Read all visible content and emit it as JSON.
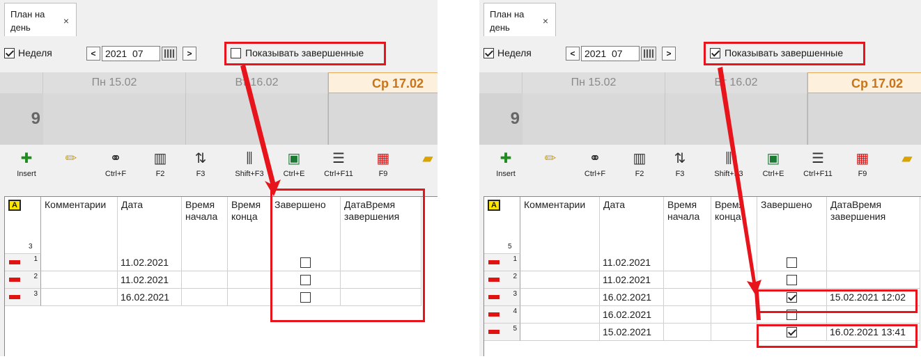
{
  "left": {
    "tab_title": "План на день",
    "tab_close": "×",
    "week_label": "Неделя",
    "week_checked": true,
    "year": "2021",
    "month": "07",
    "nav_prev": "<",
    "nav_next": ">",
    "show_completed_label": "Показывать завершенные",
    "show_completed_checked": false,
    "days": [
      "Пн 15.02",
      "Вт 16.02",
      "Ср 17.02"
    ],
    "hour": "9",
    "tools": [
      {
        "icon": "plus-icon",
        "label": "Insert"
      },
      {
        "icon": "pencil-icon",
        "label": ""
      },
      {
        "icon": "binoculars-icon",
        "label": "Ctrl+F"
      },
      {
        "icon": "filter-icon",
        "label": "F2"
      },
      {
        "icon": "sort-az-icon",
        "label": "F3"
      },
      {
        "icon": "columns-icon",
        "label": "Shift+F3"
      },
      {
        "icon": "excel-icon",
        "label": "Ctrl+E"
      },
      {
        "icon": "list-icon",
        "label": "Ctrl+F11"
      },
      {
        "icon": "colors-icon",
        "label": "F9"
      },
      {
        "icon": "folder-search-icon",
        "label": ""
      }
    ],
    "row_count": "3",
    "columns": [
      "Комментарии",
      "Дата",
      "Время начала",
      "Время конца",
      "Завершено",
      "ДатаВремя завершения"
    ],
    "rows": [
      {
        "n": "1",
        "date": "11.02.2021",
        "done": false,
        "done_at": ""
      },
      {
        "n": "2",
        "date": "11.02.2021",
        "done": false,
        "done_at": ""
      },
      {
        "n": "3",
        "date": "16.02.2021",
        "done": false,
        "done_at": ""
      }
    ]
  },
  "right": {
    "tab_title": "План на день",
    "tab_close": "×",
    "week_label": "Неделя",
    "week_checked": true,
    "year": "2021",
    "month": "07",
    "nav_prev": "<",
    "nav_next": ">",
    "show_completed_label": "Показывать завершенные",
    "show_completed_checked": true,
    "days": [
      "Пн 15.02",
      "Вт 16.02",
      "Ср 17.02"
    ],
    "hour": "9",
    "tools": [
      {
        "icon": "plus-icon",
        "label": "Insert"
      },
      {
        "icon": "pencil-icon",
        "label": ""
      },
      {
        "icon": "binoculars-icon",
        "label": "Ctrl+F"
      },
      {
        "icon": "filter-icon",
        "label": "F2"
      },
      {
        "icon": "sort-az-icon",
        "label": "F3"
      },
      {
        "icon": "columns-icon",
        "label": "Shift+F3"
      },
      {
        "icon": "excel-icon",
        "label": "Ctrl+E"
      },
      {
        "icon": "list-icon",
        "label": "Ctrl+F11"
      },
      {
        "icon": "colors-icon",
        "label": "F9"
      },
      {
        "icon": "folder-search-icon",
        "label": ""
      }
    ],
    "row_count": "5",
    "columns": [
      "Комментарии",
      "Дата",
      "Время начала",
      "Время конца",
      "Завершено",
      "ДатаВремя завершения"
    ],
    "rows": [
      {
        "n": "1",
        "date": "11.02.2021",
        "done": false,
        "done_at": ""
      },
      {
        "n": "2",
        "date": "11.02.2021",
        "done": false,
        "done_at": ""
      },
      {
        "n": "3",
        "date": "16.02.2021",
        "done": true,
        "done_at": "15.02.2021 12:02"
      },
      {
        "n": "4",
        "date": "16.02.2021",
        "done": false,
        "done_at": ""
      },
      {
        "n": "5",
        "date": "15.02.2021",
        "done": true,
        "done_at": "16.02.2021 13:41"
      }
    ]
  },
  "colors": {
    "highlight": "#e8141c",
    "today_text": "#c8741a",
    "row_marker": "#e01212"
  }
}
